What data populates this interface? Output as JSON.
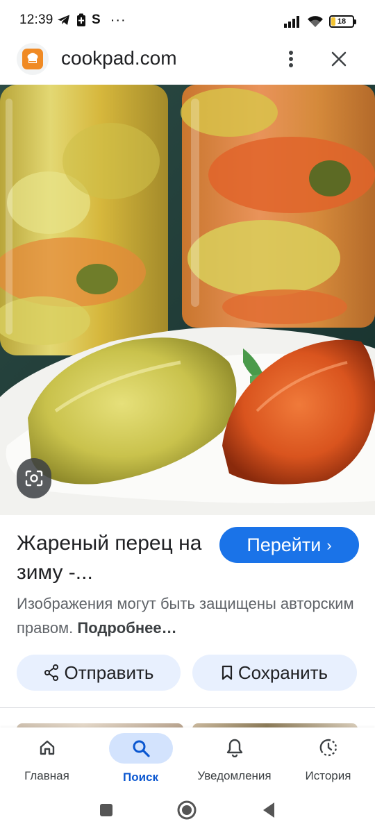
{
  "status_bar": {
    "time": "12:39",
    "app_letter": "S",
    "more": "···",
    "battery": "18",
    "battery_level": 0.18,
    "icons": [
      "telegram-icon",
      "battery-saver-icon",
      "signal-icon",
      "wifi-icon",
      "battery-icon"
    ]
  },
  "browser": {
    "site": "cookpad.com",
    "favicon": "cookpad-chef-hat-icon",
    "icons": [
      "more-vert-icon",
      "close-icon"
    ]
  },
  "result": {
    "title": "Жареный перец на зиму -...",
    "go_label": "Перейти",
    "copyright_text": "Изображения могут быть защищены авторским правом.",
    "more_link": "Подробнее…",
    "share_label": "Отправить",
    "save_label": "Сохранить",
    "accent_color": "#1a73e8",
    "pill_color": "#e8f0fe"
  },
  "bottom_nav": {
    "items": [
      {
        "label": "Главная",
        "icon": "home-icon"
      },
      {
        "label": "Поиск",
        "icon": "search-icon",
        "active": true
      },
      {
        "label": "Уведомления",
        "icon": "bell-icon"
      },
      {
        "label": "История",
        "icon": "history-icon"
      }
    ]
  },
  "system_nav": {
    "icons": [
      "recent-apps-icon",
      "home-circle-icon",
      "back-icon"
    ]
  }
}
